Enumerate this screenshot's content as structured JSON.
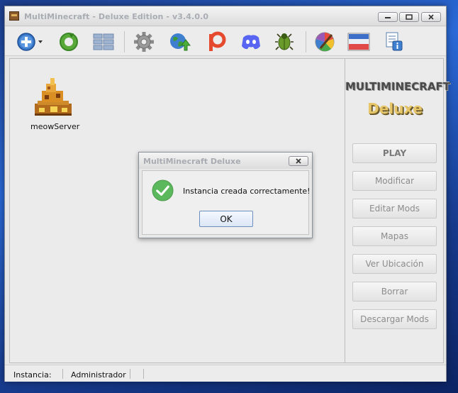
{
  "window": {
    "title": "MultiMinecraft - Deluxe Edition - v3.4.0.0"
  },
  "toolbar": {
    "buttons": [
      {
        "icon": "add-icon"
      },
      {
        "icon": "refresh-icon"
      },
      {
        "icon": "list-view-icon"
      },
      {
        "icon": "gear-icon"
      },
      {
        "icon": "globe-upload-icon"
      },
      {
        "icon": "patreon-icon"
      },
      {
        "icon": "discord-icon"
      },
      {
        "icon": "bug-icon"
      },
      {
        "icon": "palette-icon"
      },
      {
        "icon": "theme-icon"
      },
      {
        "icon": "info-document-icon"
      }
    ]
  },
  "instances": [
    {
      "name": "meowServer",
      "icon": "chest-fire-icon"
    }
  ],
  "side": {
    "logo_line1": "MULTIMINECRAFT",
    "logo_line2": "Deluxe",
    "buttons": [
      "PLAY",
      "Modificar",
      "Editar Mods",
      "Mapas",
      "Ver Ubicación",
      "Borrar",
      "Descargar Mods"
    ]
  },
  "status": {
    "instance_label": "Instancia:",
    "user": "Administrador"
  },
  "dialog": {
    "title": "MultiMinecraft Deluxe",
    "message": "Instancia creada correctamente!",
    "ok_label": "OK"
  },
  "colors": {
    "accent_blue": "#3a78c9",
    "success_green": "#5cb85c",
    "patreon_red": "#e64a2e",
    "discord_blurple": "#5865f2",
    "logo_gold": "#e7c66a"
  }
}
